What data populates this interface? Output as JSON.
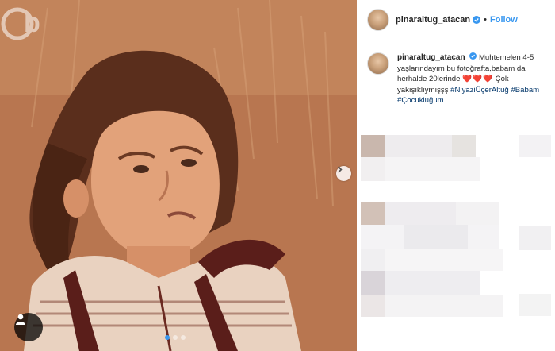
{
  "post": {
    "username": "pinaraltug_atacan",
    "separator": "•",
    "follow_label": "Follow",
    "caption": {
      "username": "pinaraltug_atacan",
      "text_part1": "Muhtemelen 4-5 yaşlarındayım bu fotoğrafta,babam da herhalde 20lerinde",
      "hearts": "❤️❤️❤️",
      "text_part2": "Çok yakışıklıymışşş",
      "hashtags": [
        "#NiyaziÜçerAltuğ",
        "#Babam",
        "#Çocukluğum"
      ]
    }
  },
  "photo": {
    "icon_user_tag": "user-silhouette-icon",
    "icon_next": "chevron-right-icon",
    "carousel": {
      "count": 3,
      "active_index": 0
    }
  },
  "colors": {
    "link_blue": "#3897f0",
    "text_dark": "#262626",
    "hashtag": "#003569",
    "heart": "#e0263b",
    "photo_tone": "#b36f48"
  }
}
